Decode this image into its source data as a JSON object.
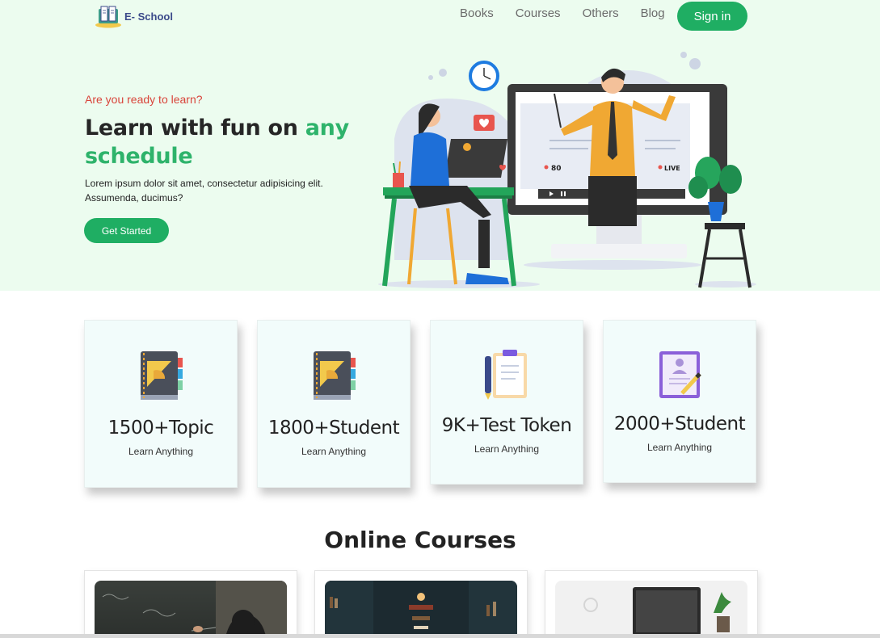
{
  "brand": {
    "name": "E- School",
    "logo_icon": "book-logo-icon"
  },
  "nav": {
    "links": [
      "Books",
      "Courses",
      "Others",
      "Blog"
    ],
    "signin_label": "Sign in"
  },
  "hero": {
    "eyebrow": "Are you ready to learn?",
    "headline_plain": "Learn with fun on ",
    "headline_accent": "any schedule",
    "body": "Lorem ipsum dolor sit amet, consectetur adipisicing elit. Assumenda, ducimus?",
    "cta_label": "Get Started",
    "illustration": {
      "viewer_count": "80",
      "live_badge": "LIVE"
    }
  },
  "stats": [
    {
      "value": "1500+Topic",
      "caption": "Learn Anything",
      "icon": "notebook-ruler-icon"
    },
    {
      "value": "1800+Student",
      "caption": "Learn Anything",
      "icon": "notebook-ruler-icon"
    },
    {
      "value": "9K+Test Token",
      "caption": "Learn Anything",
      "icon": "clipboard-pen-icon"
    },
    {
      "value": "2000+Student",
      "caption": "Learn Anything",
      "icon": "profile-document-icon"
    }
  ],
  "courses": {
    "title": "Online Courses",
    "items": [
      {
        "image": "chalkboard-photo"
      },
      {
        "image": "library-photo"
      },
      {
        "image": "laptop-desk-photo"
      }
    ]
  },
  "colors": {
    "accent": "#1fae63",
    "eyebrow": "#d9443a",
    "hero_bg": "#ecfcef",
    "card_bg": "#f2fcfb"
  }
}
